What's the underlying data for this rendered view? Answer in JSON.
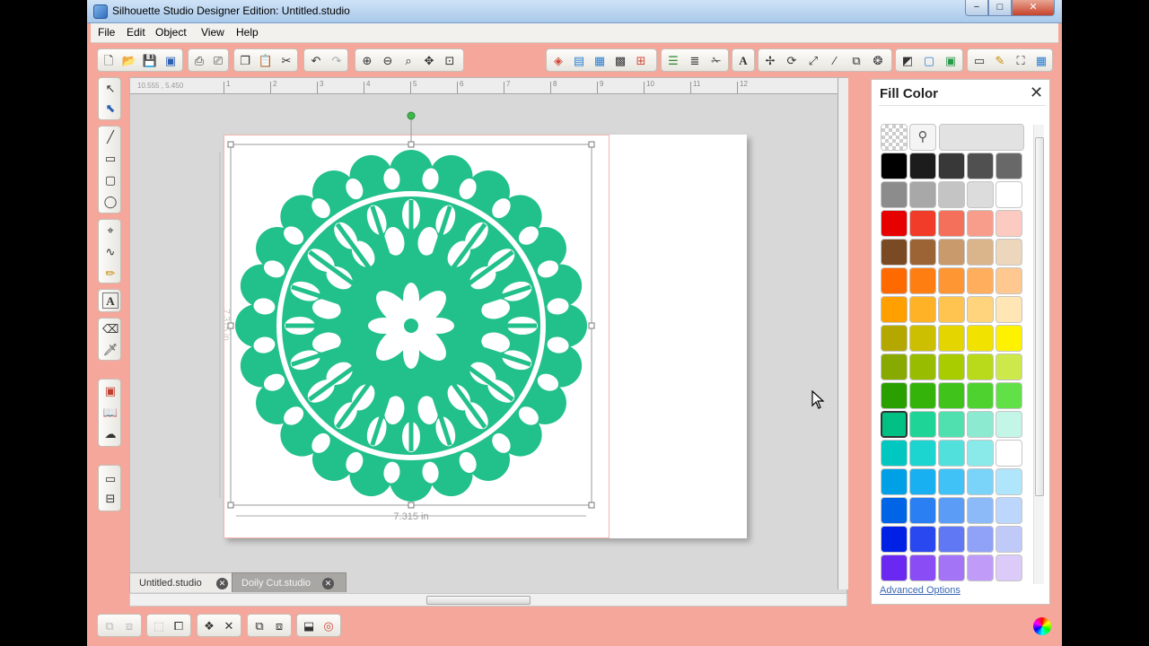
{
  "window": {
    "title": "Silhouette Studio Designer Edition: Untitled.studio",
    "min_label": "−",
    "max_label": "□",
    "close_label": "✕"
  },
  "menu": {
    "items": [
      "File",
      "Edit",
      "Object",
      "View",
      "Help"
    ]
  },
  "ruler": {
    "coords": "10.555 , 5.450",
    "h_ticks": [
      "1",
      "2",
      "3",
      "4",
      "5",
      "6",
      "7",
      "8",
      "9",
      "10",
      "11",
      "12"
    ]
  },
  "selection": {
    "width_label": "7.315 in",
    "height_label": "7.315 in"
  },
  "tabs": [
    {
      "label": "Untitled.studio",
      "active": true
    },
    {
      "label": "Doily Cut.studio",
      "active": false
    }
  ],
  "colors": {
    "doily": "#22c08a",
    "accent_window": "#f4a79a"
  },
  "fill_panel": {
    "title": "Fill Color",
    "close_label": "✕",
    "advanced_options": "Advanced Options",
    "swatch_rows": [
      [
        "#000000",
        "#1c1c1c",
        "#383838",
        "#505050",
        "#686868"
      ],
      [
        "#8c8c8c",
        "#a8a8a8",
        "#c4c4c4",
        "#dcdcdc",
        "#ffffff"
      ],
      [
        "#e60000",
        "#f03c28",
        "#f4705a",
        "#f89c8c",
        "#fccac0"
      ],
      [
        "#7a4a24",
        "#9c6434",
        "#c89a6c",
        "#dab48a",
        "#ecd6bc"
      ],
      [
        "#ff6a00",
        "#ff7e12",
        "#ff9634",
        "#ffae5e",
        "#ffc890"
      ],
      [
        "#ffa000",
        "#ffb226",
        "#ffc450",
        "#ffd47c",
        "#ffe6b4"
      ],
      [
        "#b4a800",
        "#ccbe00",
        "#e4d400",
        "#f2e200",
        "#fff200"
      ],
      [
        "#88aa00",
        "#98bc00",
        "#a8cc00",
        "#b8da1a",
        "#cce84a"
      ],
      [
        "#2aa000",
        "#34b40a",
        "#40c41c",
        "#4ed230",
        "#62e048"
      ],
      [
        "#00c084",
        "#1ed496",
        "#50e0b0",
        "#8cead0",
        "#c4f6e8"
      ],
      [
        "#00c8c0",
        "#1cd4d0",
        "#52e0dc",
        "#8aeaea",
        "#ffffff"
      ],
      [
        "#00a0e6",
        "#18b0f0",
        "#40c2f6",
        "#7ad4fa",
        "#b0e6fc"
      ],
      [
        "#0064e6",
        "#2a80f2",
        "#5a9cf6",
        "#8cbaf8",
        "#bcd6fc"
      ],
      [
        "#0020e6",
        "#2a48f0",
        "#6078f4",
        "#90a2f8",
        "#c0caf8"
      ],
      [
        "#6a28f0",
        "#8a4cf4",
        "#a474f6",
        "#c09cf8",
        "#dccaf8"
      ]
    ],
    "selected": [
      9,
      0
    ]
  },
  "icons": {
    "toolbar": [
      "new-icon",
      "open-icon",
      "save-icon",
      "save-library-icon",
      "print-icon",
      "print-cut-icon",
      "copy-icon",
      "paste-icon",
      "cut-icon",
      "undo-icon",
      "redo-icon",
      "zoom-in-icon",
      "zoom-out-icon",
      "zoom-select-icon",
      "pan-icon",
      "fit-page-icon",
      "fill-panel-icon",
      "page-settings-icon",
      "grid-icon",
      "trace-icon",
      "registration-icon",
      "align-icon",
      "distribute-icon",
      "cut-settings-icon",
      "text-style-icon",
      "transform-icon",
      "rotate-icon",
      "scale-icon",
      "shear-icon",
      "replicate-icon",
      "offset-icon",
      "fill-icon",
      "line-icon",
      "shadow-icon",
      "store-icon",
      "pencil-icon",
      "fullscreen-icon",
      "grid-view-icon"
    ]
  }
}
